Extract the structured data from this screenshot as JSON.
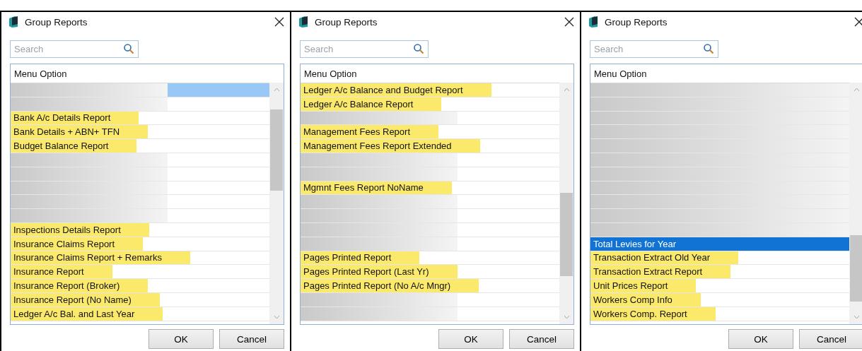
{
  "dialogs": [
    {
      "title": "Group Reports",
      "search": {
        "placeholder": "Search"
      },
      "list": {
        "column": "Menu Option",
        "rows": [
          {
            "kind": "redacted",
            "selected": true
          },
          {
            "kind": "redacted",
            "selected": false
          },
          {
            "kind": "item",
            "label": "Bank A/c Details Report",
            "highlighted": true,
            "selected": false
          },
          {
            "kind": "item",
            "label": "Bank Details + ABN+ TFN",
            "highlighted": true,
            "selected": false
          },
          {
            "kind": "item",
            "label": "Budget Balance Report",
            "highlighted": true,
            "selected": false
          },
          {
            "kind": "redacted",
            "selected": false
          },
          {
            "kind": "redacted",
            "selected": false
          },
          {
            "kind": "redacted",
            "selected": false
          },
          {
            "kind": "redacted",
            "selected": false
          },
          {
            "kind": "redacted",
            "selected": false
          },
          {
            "kind": "item",
            "label": "Inspections Details Report",
            "highlighted": true,
            "selected": false
          },
          {
            "kind": "item",
            "label": "Insurance Claims Report",
            "highlighted": true,
            "selected": false
          },
          {
            "kind": "item",
            "label": "Insurance Claims Report + Remarks",
            "highlighted": true,
            "selected": false
          },
          {
            "kind": "item",
            "label": "Insurance Report",
            "highlighted": true,
            "selected": false
          },
          {
            "kind": "item",
            "label": "Insurance Report (Broker)",
            "highlighted": true,
            "selected": false
          },
          {
            "kind": "item",
            "label": "Insurance Report (No Name)",
            "highlighted": true,
            "selected": false
          },
          {
            "kind": "item",
            "label": "Ledger A/c Bal. and Last Year",
            "highlighted": true,
            "selected": false
          }
        ]
      },
      "buttons": [
        "OK",
        "Cancel"
      ]
    },
    {
      "title": "Group Reports",
      "search": {
        "placeholder": "Search"
      },
      "list": {
        "column": "Menu Option",
        "rows": [
          {
            "kind": "item",
            "label": "Ledger A/c Balance and Budget Report",
            "highlighted": true,
            "selected": false
          },
          {
            "kind": "item",
            "label": "Ledger A/c Balance Report",
            "highlighted": true,
            "selected": false
          },
          {
            "kind": "redacted",
            "selected": false
          },
          {
            "kind": "item",
            "label": "Management Fees Report",
            "highlighted": true,
            "selected": false
          },
          {
            "kind": "item",
            "label": "Management Fees Report Extended",
            "highlighted": true,
            "selected": false
          },
          {
            "kind": "redacted",
            "selected": false
          },
          {
            "kind": "redacted",
            "selected": false
          },
          {
            "kind": "item",
            "label": "Mgmnt Fees Report NoName",
            "highlighted": true,
            "selected": false
          },
          {
            "kind": "redacted",
            "selected": false
          },
          {
            "kind": "redacted",
            "selected": false
          },
          {
            "kind": "redacted",
            "selected": false
          },
          {
            "kind": "redacted",
            "selected": false
          },
          {
            "kind": "item",
            "label": "Pages Printed Report",
            "highlighted": true,
            "selected": false
          },
          {
            "kind": "item",
            "label": "Pages Printed Report (Last Yr)",
            "highlighted": true,
            "selected": false
          },
          {
            "kind": "item",
            "label": "Pages Printed Report (No A/c Mngr)",
            "highlighted": true,
            "selected": false
          },
          {
            "kind": "redacted",
            "selected": false
          },
          {
            "kind": "redacted",
            "selected": false
          }
        ]
      },
      "buttons": [
        "OK",
        "Cancel"
      ]
    },
    {
      "title": "Group Reports",
      "search": {
        "placeholder": "Search"
      },
      "list": {
        "column": "Menu Option",
        "rows": [
          {
            "kind": "redacted",
            "selected": false
          },
          {
            "kind": "redacted",
            "selected": false
          },
          {
            "kind": "redacted",
            "selected": false
          },
          {
            "kind": "redacted",
            "selected": false
          },
          {
            "kind": "redacted",
            "selected": false
          },
          {
            "kind": "redacted",
            "selected": false
          },
          {
            "kind": "redacted",
            "selected": false
          },
          {
            "kind": "redacted",
            "selected": false
          },
          {
            "kind": "redacted",
            "selected": false
          },
          {
            "kind": "redacted",
            "selected": false
          },
          {
            "kind": "redacted",
            "selected": false
          },
          {
            "kind": "item",
            "label": "Total Levies for Year",
            "highlighted": false,
            "selected": true
          },
          {
            "kind": "item",
            "label": "Transaction Extract Old Year",
            "highlighted": true,
            "selected": false
          },
          {
            "kind": "item",
            "label": "Transaction Extract Report",
            "highlighted": true,
            "selected": false
          },
          {
            "kind": "item",
            "label": "Unit Prices Report",
            "highlighted": true,
            "selected": false
          },
          {
            "kind": "item",
            "label": "Workers Comp Info",
            "highlighted": true,
            "selected": false
          },
          {
            "kind": "item",
            "label": "Workers Comp. Report",
            "highlighted": true,
            "selected": false
          }
        ]
      },
      "buttons": [
        "OK",
        "Cancel"
      ]
    }
  ]
}
